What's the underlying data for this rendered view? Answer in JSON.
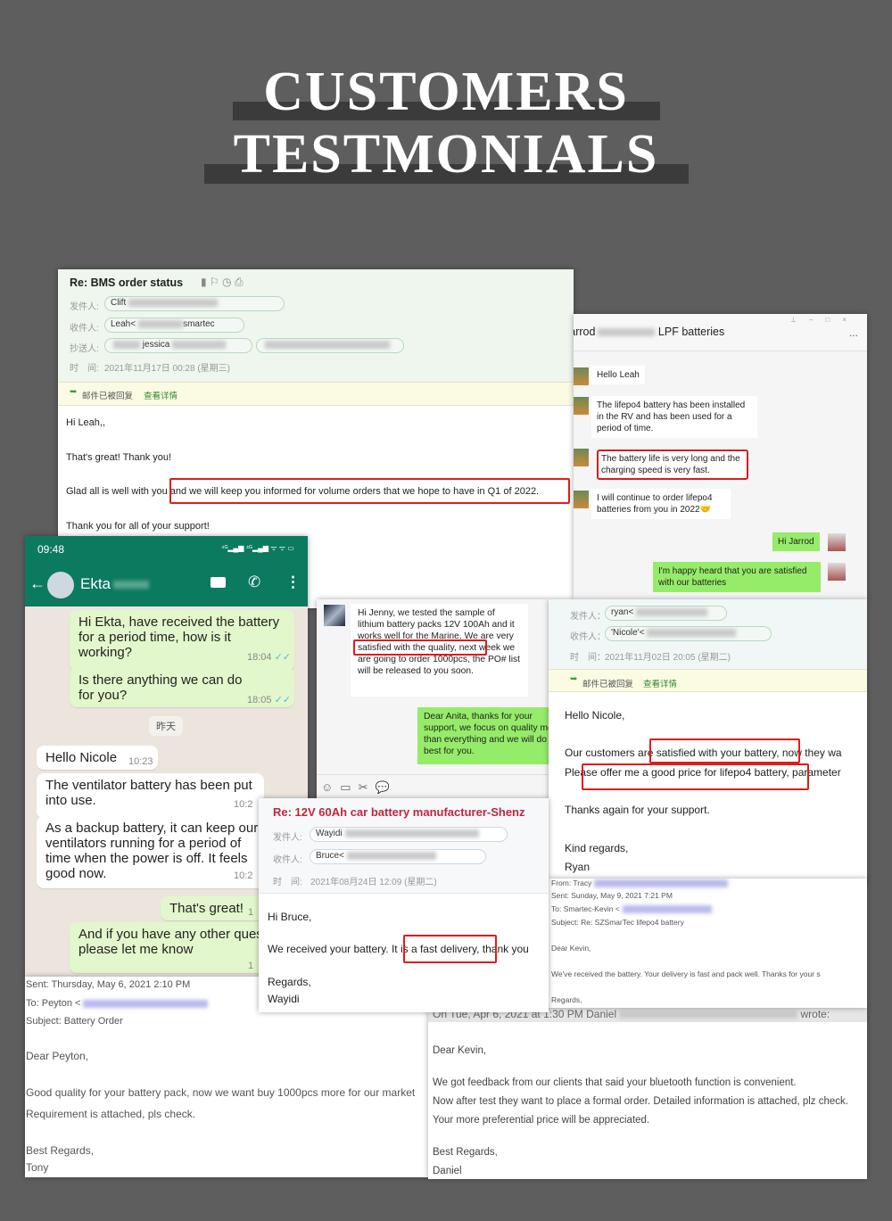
{
  "header": {
    "line1": "CUSTOMERS",
    "line2": "TESTMONIALS"
  },
  "email_bms": {
    "subject": "Re: BMS order status",
    "from_label": "发件人:",
    "from": "Clift",
    "to_label": "收件人:",
    "to": "Leah<",
    "to_domain": "smartec",
    "cc_label": "抄送人:",
    "cc": "jessica",
    "time_label": "时　间:",
    "time": "2021年11月17日 00:28 (星期三)",
    "reply_notice": "邮件已被回复",
    "reply_link": "查看详情",
    "body": [
      "Hi Leah,,",
      "That's great! Thank you!",
      "Glad all is well with you and we will keep you informed for volume orders that we hope to have in Q1 of 2022.",
      "Thank you for all of your support!"
    ]
  },
  "wechat_jarrod": {
    "title_name": "Jarrod",
    "title_suffix": "LPF batteries",
    "more": "...",
    "messages": [
      {
        "side": "in",
        "text": "Hello Leah"
      },
      {
        "side": "in",
        "text": "The lifepo4 battery has been installed in the RV and has been used for a period of time."
      },
      {
        "side": "in",
        "text": "The battery life is very long and the charging speed is very fast.",
        "highlighted": true
      },
      {
        "side": "in",
        "text": "I will continue to order lifepo4 batteries from you in 2022🤝"
      },
      {
        "side": "out",
        "text": "Hi Jarrod"
      },
      {
        "side": "out",
        "text": "I'm happy heard that you are satisfied with our batteries"
      }
    ]
  },
  "whatsapp": {
    "status_time": "09:48",
    "status_icons": "⁴ᴳ▂▄▆ ⁴ᴳ▂▄▆ ᯤ ᯤ ▭",
    "contact": "Ekta",
    "day_separator": "昨天",
    "colors": {
      "header": "#0b7a5f",
      "bg": "#ece5dd",
      "out": "#e2f7cb"
    },
    "messages": [
      {
        "side": "out",
        "text": "Hi Ekta, have received the battery for a period time, how is it working?",
        "time": "18:04"
      },
      {
        "side": "out",
        "text": "Is there anything we can do for you?",
        "time": "18:05"
      },
      {
        "side": "in",
        "text": "Hello Nicole",
        "time": "10:23"
      },
      {
        "side": "in",
        "text": "The ventilator battery has been put into use.",
        "time": "10:2"
      },
      {
        "side": "in",
        "text": "As a backup battery, it can keep our ventilators running for a period of time when the power is off. It feels good now.",
        "time": "10:2"
      },
      {
        "side": "out",
        "text": "That's great!",
        "time": "1"
      },
      {
        "side": "out",
        "text": "And if you have any other questions please let me know",
        "time": "1"
      }
    ]
  },
  "chat_jenny": {
    "incoming": "Hi Jenny,  we tested the sample of lithium battery packs 12V 100Ah and it works well for the Marine. We are very satisfied with the quality, next week we are going to order 1000pcs, the PO# list will be released to you soon.",
    "highlight": "very satisfied with the quality",
    "outgoing": "Dear Anita, thanks for your support, we focus on quality more than everything and we will do our best for you."
  },
  "email_nicole": {
    "from_label": "发件人：",
    "from": "ryan<",
    "to_label": "收件人：",
    "to": "'Nicole'<",
    "time_label": "时　间：",
    "time": "2021年11月02日 20:05 (星期二)",
    "reply_notice": "邮件已被回复",
    "reply_link": "查看详情",
    "body": [
      "Hello Nicole,",
      "Our customers are satisfied with your battery, now they wa",
      "Please offer me a good price for lifepo4 battery, parameter",
      "Thanks again for your support.",
      "Kind regards,",
      "Ryan"
    ]
  },
  "email_wayidi": {
    "subject": "Re: 12V 60Ah car battery manufacturer-Shenz",
    "from_label": "发件人:",
    "from": "Wayidi",
    "to_label": "收件人:",
    "to": "Bruce<",
    "time_label": "时　间:",
    "time": "2021年08月24日 12:09 (星期二)",
    "body": [
      "Hi Bruce,",
      "We received your battery. It is a fast delivery, thank you",
      "Regards,",
      "Wayidi"
    ],
    "accent": "#c0263c"
  },
  "email_tracy": {
    "from": "From: Tracy",
    "sent": "Sent: Sunday, May 9, 2021 7:21 PM",
    "to": "To: Smartec-Kevin <",
    "subject": "Subject: Re: SZSmarTec lifepo4 battery",
    "body": [
      "Dear Kevin,",
      "We've received the battery. Your delivery is fast and pack well. Thanks for your s",
      "Regards,"
    ]
  },
  "email_peyton": {
    "sent": "Sent: Thursday, May 6, 2021 2:10 PM",
    "to": "To: Peyton <",
    "subject": "Subject: Battery Order",
    "body": [
      "Dear Peyton,",
      "Good quality for your battery pack, now we want buy 1000pcs more for our market",
      "Requirement is attached, pls check.",
      "Best Regards,",
      "Tony"
    ]
  },
  "email_daniel": {
    "quote_header": "On Tue, Apr 6, 2021 at 1:30 PM Daniel",
    "quote_wrote": "wrote:",
    "body": [
      "Dear Kevin,",
      "We got feedback from our clients that said your bluetooth function is convenient.",
      "Now after test they want to place a formal order. Detailed information is attached, plz check.",
      "Your more preferential price will be appreciated.",
      "Best Regards,",
      "Daniel"
    ]
  }
}
